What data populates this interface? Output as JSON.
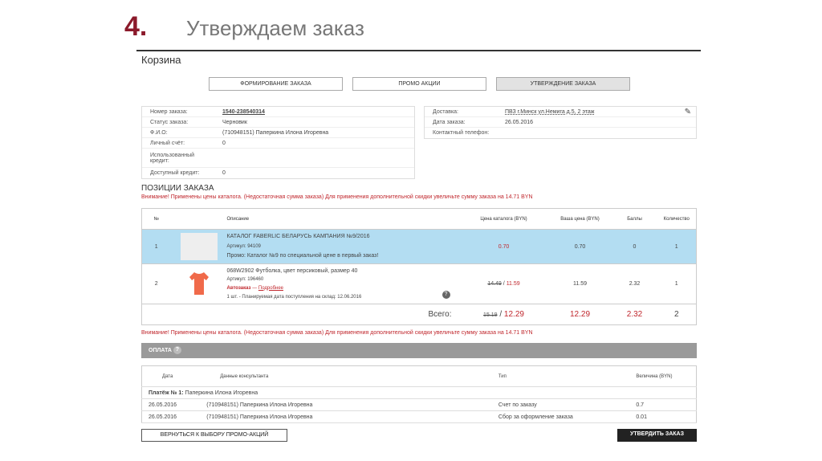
{
  "slide": {
    "number": "4.",
    "title": "Утверждаем заказ"
  },
  "cart_title": "Корзина",
  "tabs": [
    "ФОРМИРОВАНИЕ ЗАКАЗА",
    "ПРОМО АКЦИИ",
    "УТВЕРЖДЕНИЕ ЗАКАЗА"
  ],
  "order_info": [
    {
      "k": "Номер заказа:",
      "v": "1540-238540314"
    },
    {
      "k": "Статус заказа:",
      "v": "Черновик"
    },
    {
      "k": "Ф.И.О:",
      "v": "(710948151) Паперкина Илона Игоревна"
    },
    {
      "k": "Личный счёт:",
      "v": "0"
    },
    {
      "k": "Использованный кредит:",
      "v": ""
    },
    {
      "k": "Доступный кредит:",
      "v": "0"
    }
  ],
  "delivery_info": [
    {
      "k": "Доставка:",
      "v": "ПВЗ г.Минск ул.Немига д.5, 2 этаж"
    },
    {
      "k": "Дата заказа:",
      "v": "26.05.2016"
    },
    {
      "k": "Контактный телефон:",
      "v": ""
    }
  ],
  "positions_title": "ПОЗИЦИИ ЗАКАЗА",
  "warning": "Внимание! Применены цены каталога. (Недостаточная сумма заказа) Для применения дополнительной скидки увеличьте сумму заказа на 14.71 BYN",
  "items_headers": [
    "№",
    "Описание",
    "Цена каталога (BYN)",
    "Ваша цена (BYN)",
    "Баллы",
    "Количество"
  ],
  "items": [
    {
      "n": "1",
      "name": "КАТАЛОГ FABERLIC БЕЛАРУСЬ КАМПАНИЯ №9/2016",
      "article": "Артикул: 94109",
      "promo": "Промо: Каталог №9 по специальной цене в первый заказ!",
      "catalog_price": "0.70",
      "price": "0.70",
      "points": "0",
      "qty": "1",
      "color": "#b3ddf2"
    },
    {
      "n": "2",
      "name": "068W2902 Футболка, цвет персиковый, размер 40",
      "article": "Артикул: 196460",
      "auto": "Автозаказ",
      "auto_link": "Подробнее",
      "plan": "1 шт. - Планируемая дата поступления на склад: 12.06.2016",
      "catalog_old": "14.49",
      "catalog_price": "11.59",
      "price": "11.59",
      "points": "2.32",
      "qty": "1"
    }
  ],
  "total": {
    "label": "Всего:",
    "old": "15.19",
    "catalog": "12.29",
    "price": "12.29",
    "points": "2.32",
    "qty": "2"
  },
  "payment": {
    "title": "ОПЛАТА",
    "headers": [
      "Дата",
      "Данные консультанта",
      "Тип",
      "Величина (BYN)"
    ],
    "group_label": "Платёж № 1:",
    "group_name": "Паперкина Илона Игоревна",
    "rows": [
      {
        "date": "26.05.2016",
        "who": "(710948151) Паперкина Илона Игоревна",
        "type": "Счет по заказу",
        "value": "0.7"
      },
      {
        "date": "26.05.2016",
        "who": "(710948151) Паперкина Илона Игоревна",
        "type": "Сбор за оформление заказа",
        "value": "0.01"
      }
    ]
  },
  "buttons": {
    "back": "ВЕРНУТЬСЯ К ВЫБОРУ ПРОМО-АКЦИЙ",
    "confirm": "УТВЕРДИТЬ ЗАКАЗ"
  }
}
